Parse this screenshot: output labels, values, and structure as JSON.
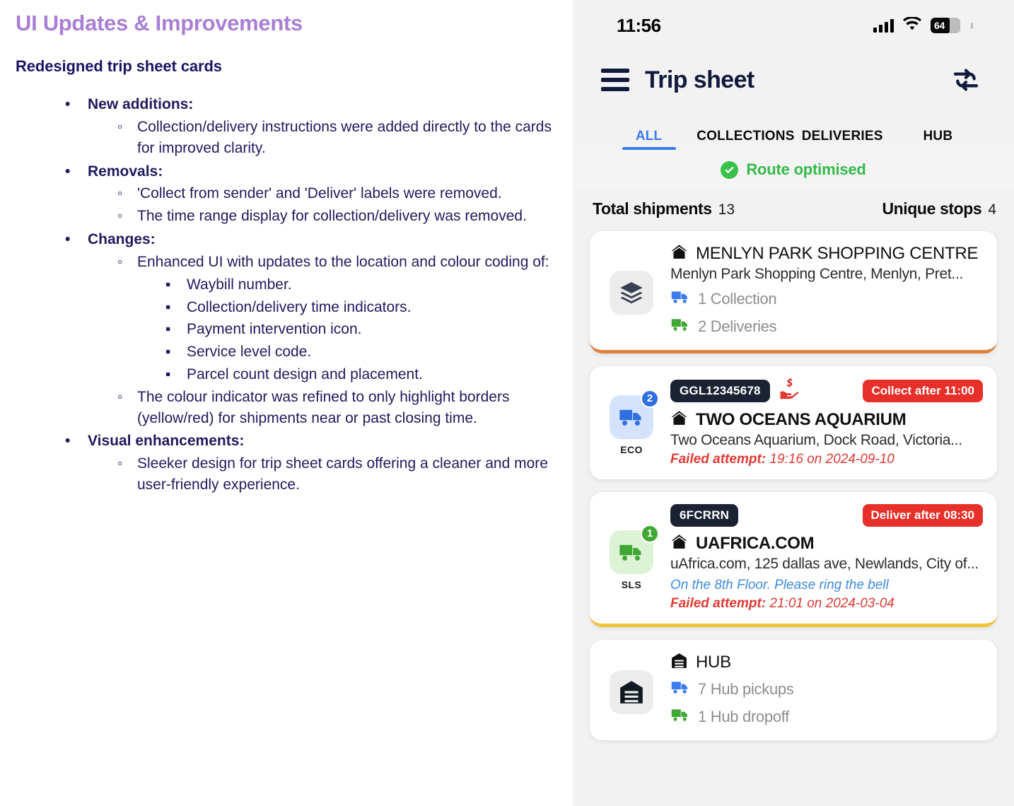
{
  "doc": {
    "title": "UI Updates & Improvements",
    "subtitle": "Redesigned trip sheet cards",
    "sections": [
      {
        "heading": "New additions:",
        "items": [
          {
            "text": "Collection/delivery instructions were added directly to the cards for improved clarity."
          }
        ]
      },
      {
        "heading": "Removals:",
        "items": [
          {
            "text": "'Collect from sender' and 'Deliver' labels were removed."
          },
          {
            "text": "The time range display for collection/delivery was removed."
          }
        ]
      },
      {
        "heading": "Changes:",
        "items": [
          {
            "text": "Enhanced UI with updates to the location and colour coding of:",
            "subitems": [
              "Waybill number.",
              "Collection/delivery time indicators.",
              "Payment intervention icon.",
              "Service level code.",
              "Parcel count design and placement."
            ]
          },
          {
            "text": "The colour indicator was refined to only highlight borders (yellow/red) for shipments near or past closing time."
          }
        ]
      },
      {
        "heading": "Visual enhancements:",
        "items": [
          {
            "text": "Sleeker design for trip sheet cards offering a cleaner and more user-friendly experience."
          }
        ]
      }
    ]
  },
  "phone": {
    "statusbar": {
      "time": "11:56",
      "signal_icon": "cellular-signal-icon",
      "wifi_icon": "wifi-icon",
      "battery_level": "64",
      "battery_icon": "battery-icon"
    },
    "appbar": {
      "menu_icon": "hamburger-menu-icon",
      "title": "Trip sheet",
      "refresh_icon": "refresh-sync-icon"
    },
    "tabs": [
      {
        "label": "ALL",
        "active": true
      },
      {
        "label": "COLLECTIONS",
        "active": false
      },
      {
        "label": "DELIVERIES",
        "active": false
      },
      {
        "label": "HUB",
        "active": false
      }
    ],
    "route_banner": {
      "icon": "check-circle-icon",
      "text": "Route optimised",
      "color": "#36b94a"
    },
    "totals": {
      "shipments_label": "Total shipments",
      "shipments_value": "13",
      "stops_label": "Unique stops",
      "stops_value": "4"
    },
    "cards": [
      {
        "id": "menlyn-park",
        "icon": "layers-stack-icon",
        "icon_bg": "gray",
        "name": "MENLYN PARK SHOPPING CENTRE",
        "name_icon": "home-icon",
        "address": "Menlyn Park Shopping Centre, Menlyn, Pret...",
        "stats": [
          {
            "icon": "collection-truck-icon",
            "text": "1 Collection",
            "color": "#3b7bf0"
          },
          {
            "icon": "delivery-truck-icon",
            "text": "2 Deliveries",
            "color": "#3fa832"
          }
        ],
        "border": "orange",
        "border_color": "#e08040"
      },
      {
        "id": "two-oceans-aquarium",
        "icon": "collection-truck-icon",
        "icon_bg": "blue",
        "parcel_count": "2",
        "service_code": "ECO",
        "waybill": "GGL12345678",
        "payment_icon": "payment-intervention-icon",
        "time_badge": "Collect after 11:00",
        "name": "TWO OCEANS AQUARIUM",
        "name_icon": "home-icon",
        "address": "Two Oceans Aquarium, Dock Road, Victoria...",
        "failed_label": "Failed attempt:",
        "failed_value": "19:16 on 2024-09-10",
        "border": "none"
      },
      {
        "id": "uafrica-com",
        "icon": "delivery-truck-icon",
        "icon_bg": "green",
        "parcel_count": "1",
        "service_code": "SLS",
        "waybill": "6FCRRN",
        "time_badge": "Deliver after 08:30",
        "name": "UAFRICA.COM",
        "name_icon": "home-icon",
        "address": "uAfrica.com, 125 dallas ave, Newlands, City of...",
        "instruction": "On the 8th Floor. Please ring the bell",
        "failed_label": "Failed attempt:",
        "failed_value": "21:01 on 2024-03-04",
        "border": "yellow",
        "border_color": "#f2c23c"
      },
      {
        "id": "hub",
        "icon": "warehouse-icon",
        "icon_bg": "gray",
        "name": "HUB",
        "name_icon": "warehouse-icon",
        "stats": [
          {
            "icon": "collection-truck-icon",
            "text": "7 Hub pickups",
            "color": "#3b7bf0"
          },
          {
            "icon": "delivery-truck-icon",
            "text": "1 Hub dropoff",
            "color": "#3fa832"
          }
        ],
        "border": "none"
      }
    ]
  }
}
